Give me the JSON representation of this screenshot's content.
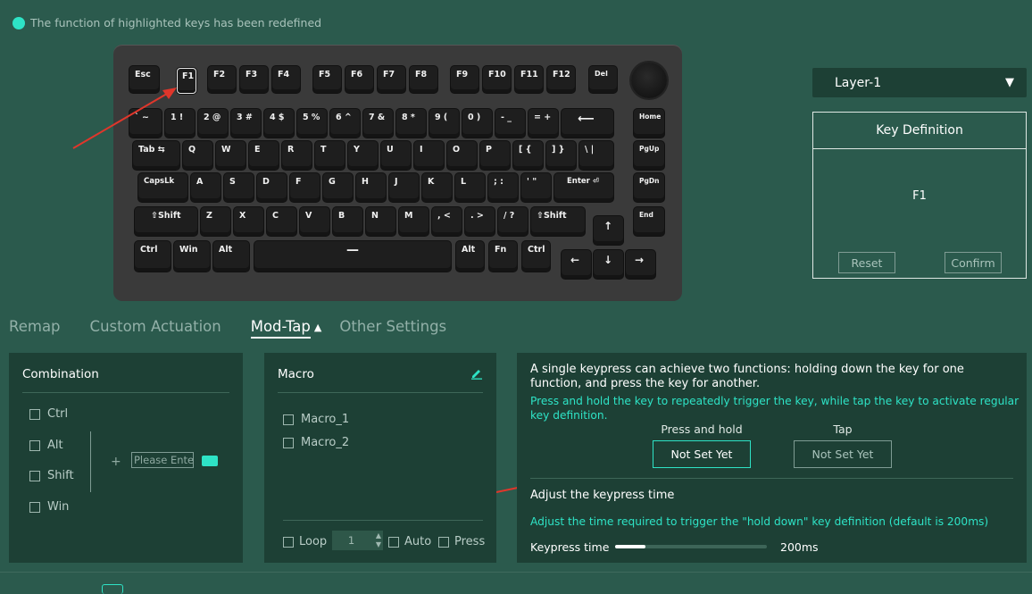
{
  "notice": {
    "text": "The function of highlighted keys has been redefined",
    "dot_color": "#2ee3c6"
  },
  "keyboard": {
    "selected_key": "F1",
    "rows": [
      [
        "Esc",
        "F1",
        "F2",
        "F3",
        "F4",
        "F5",
        "F6",
        "F7",
        "F8",
        "F9",
        "F10",
        "F11",
        "F12",
        "Del"
      ],
      [
        "` ~",
        "1 !",
        "2 @",
        "3 #",
        "4 $",
        "5 %",
        "6 ^",
        "7 &",
        "8 *",
        "9 (",
        "0 )",
        "- _",
        "= +",
        "⟵",
        "Home"
      ],
      [
        "Tab ⇆",
        "Q",
        "W",
        "E",
        "R",
        "T",
        "Y",
        "U",
        "I",
        "O",
        "P",
        "[ {",
        "] }",
        "\\ |",
        "PgUp"
      ],
      [
        "CapsLk",
        "A",
        "S",
        "D",
        "F",
        "G",
        "H",
        "J",
        "K",
        "L",
        "; :",
        "' \"",
        "Enter ⏎",
        "PgDn"
      ],
      [
        "⇧Shift",
        "Z",
        "X",
        "C",
        "V",
        "B",
        "N",
        "M",
        ", <",
        ". >",
        "/ ?",
        "⇧Shift",
        "↑",
        "End"
      ],
      [
        "Ctrl",
        "Win",
        "Alt",
        "—",
        "Alt",
        "Fn",
        "Ctrl",
        "←",
        "↓",
        "→"
      ]
    ]
  },
  "layer_select": {
    "value": "Layer-1",
    "caret": "▼"
  },
  "key_definition": {
    "title": "Key Definition",
    "value": "F1",
    "reset_label": "Reset",
    "confirm_label": "Confirm"
  },
  "tabs": [
    {
      "label": "Remap",
      "active": false
    },
    {
      "label": "Custom Actuation",
      "active": false
    },
    {
      "label": "Mod-Tap",
      "active": true,
      "caret": "▲"
    },
    {
      "label": "Other Settings",
      "active": false
    }
  ],
  "combination": {
    "title": "Combination",
    "modifiers": [
      "Ctrl",
      "Alt",
      "Shift",
      "Win"
    ],
    "plus": "+",
    "input_placeholder": "Please Enter"
  },
  "macro": {
    "title": "Macro",
    "items": [
      "Macro_1",
      "Macro_2"
    ],
    "loop_label": "Loop",
    "loop_count": "1",
    "auto_label": "Auto",
    "press_label": "Press"
  },
  "modtap": {
    "description": "A single keypress can achieve two functions: holding down the key for one function, and press the key for another.",
    "hint": "Press and hold the key to repeatedly trigger the key, while tap the key to activate regular key definition.",
    "hold_label": "Press and hold",
    "hold_value": "Not Set Yet",
    "tap_label": "Tap",
    "tap_value": "Not Set Yet",
    "time_title": "Adjust the keypress time",
    "time_hint": "Adjust the time required to trigger the \"hold down\" key definition (default is 200ms)",
    "time_label": "Keypress time",
    "time_value": "200ms",
    "time_fraction": 0.2
  },
  "colors": {
    "accent": "#2ee3c6",
    "background": "#2b5a4d",
    "panel": "#1d4035",
    "arrow": "#e0362b"
  }
}
